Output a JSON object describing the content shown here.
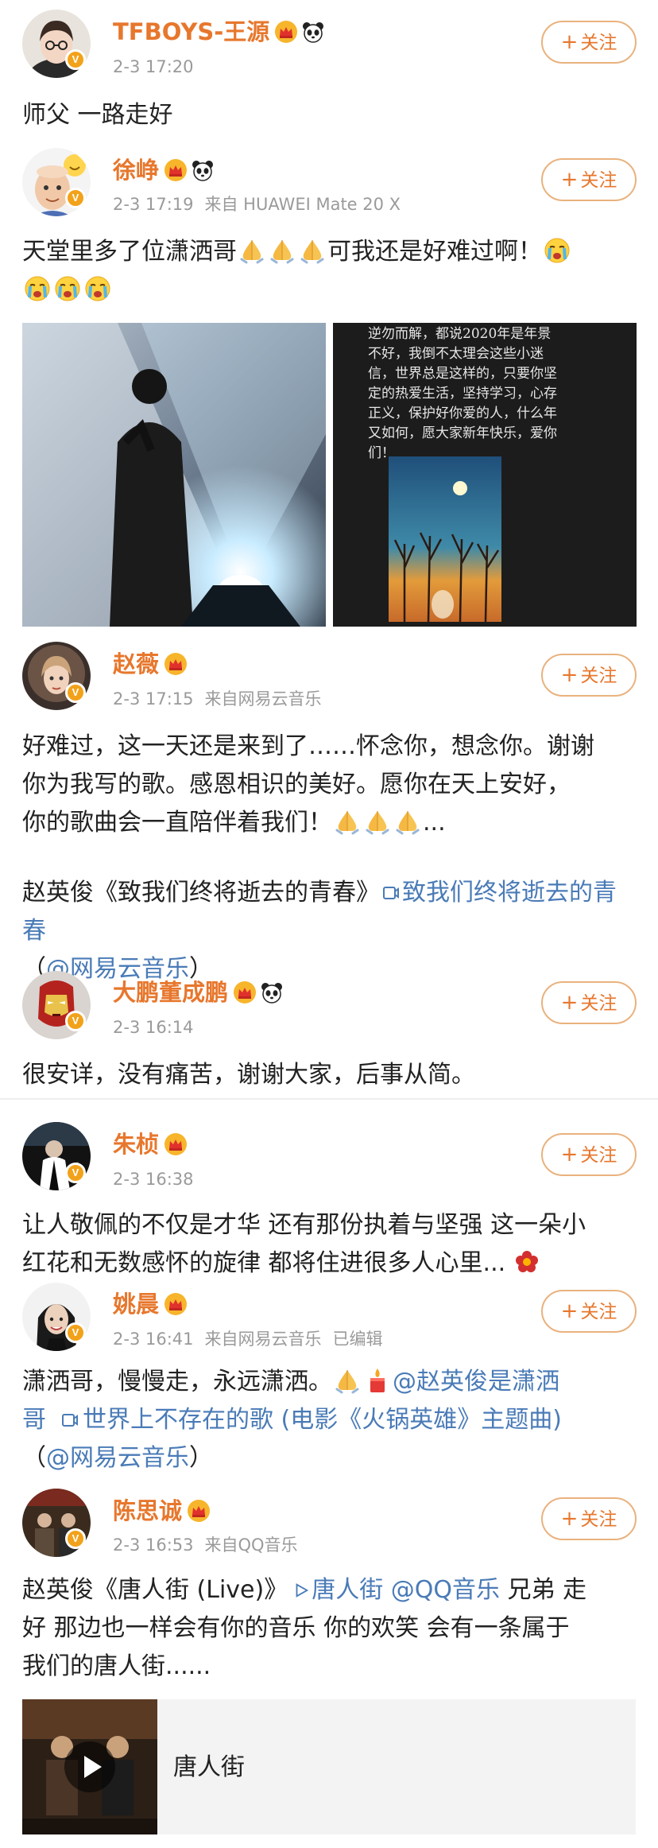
{
  "follow_label": "关注",
  "posts": [
    {
      "name": "TFBOYS-王源",
      "time": "2-3 17:20",
      "source": "",
      "edited": "",
      "text": "师父 一路走好"
    },
    {
      "name": "徐峥",
      "time": "2-3 17:19",
      "source": "来自 HUAWEI Mate 20 X",
      "edited": "",
      "text": "天堂里多了位潇洒哥",
      "text_after": "可我还是好难过啊！",
      "images": [
        {
          "description": "stage",
          "alt": "舞台照片"
        },
        {
          "description": "note",
          "lines": [
            "逆勿而解，都说2020年是年景",
            "不好，我倒不太理会这些小迷",
            "信，世界总是这样的，只要你坚",
            "定的热爱生活，坚持学习，心存",
            "正义，保护好你爱的人，什么年",
            "又如何，愿大家新年快乐，爱你",
            "们！"
          ]
        }
      ]
    },
    {
      "name": "赵薇",
      "time": "2-3 17:15",
      "source": "来自网易云音乐",
      "edited": "",
      "line1": "好难过，这一天还是来到了……怀念你，想念你。谢谢",
      "line2": "你为我写的歌。感恩相识的美好。愿你在天上安好，",
      "line3": "你的歌曲会一直陪伴着我们！",
      "line3_end": "...",
      "song_line_prefix": "赵英俊《致我们终将逝去的青春》",
      "song_link": "致我们终将逝去的青春",
      "song_link_suffix": "（",
      "mention": "@网易云音乐",
      "close_paren": "）"
    },
    {
      "name": "大鹏董成鹏",
      "time": "2-3 16:14",
      "source": "",
      "edited": "",
      "text": "很安详，没有痛苦，谢谢大家，后事从简。"
    },
    {
      "name": "朱桢",
      "time": "2-3 16:38",
      "source": "",
      "edited": "",
      "line1": "让人敬佩的不仅是才华 还有那份执着与坚强 这一朵小",
      "line2": "红花和无数感怀的旋律 都将住进很多人心里..."
    },
    {
      "name": "姚晨",
      "time": "2-3 16:41",
      "source": "来自网易云音乐",
      "edited": "已编辑",
      "line1": "潇洒哥，慢慢走，永远潇洒。",
      "mention1": "@赵英俊是潇洒",
      "line2_mention": "哥",
      "line2_link": "世界上不存在的歌 (电影《火锅英雄》主题曲)",
      "line3_open": "（",
      "mention2": "@网易云音乐",
      "line3_close": "）"
    },
    {
      "name": "陈思诚",
      "time": "2-3 16:53",
      "source": "来自QQ音乐",
      "edited": "",
      "line1_prefix": "赵英俊《唐人街 (Live)》",
      "line1_link": "唐人街",
      "line1_mention": "@QQ音乐",
      "line1_suffix": "兄弟 走",
      "line2": "好 那边也一样会有你的音乐 你的欢笑 会有一条属于",
      "line3": "我们的唐人街......",
      "music_card_title": "唐人街"
    }
  ],
  "colors": {
    "name": "#e7772d",
    "link": "#4a7bb7",
    "meta": "#9a9a9a",
    "badge": "#f2a21a",
    "follow_border": "#e9b27e"
  }
}
